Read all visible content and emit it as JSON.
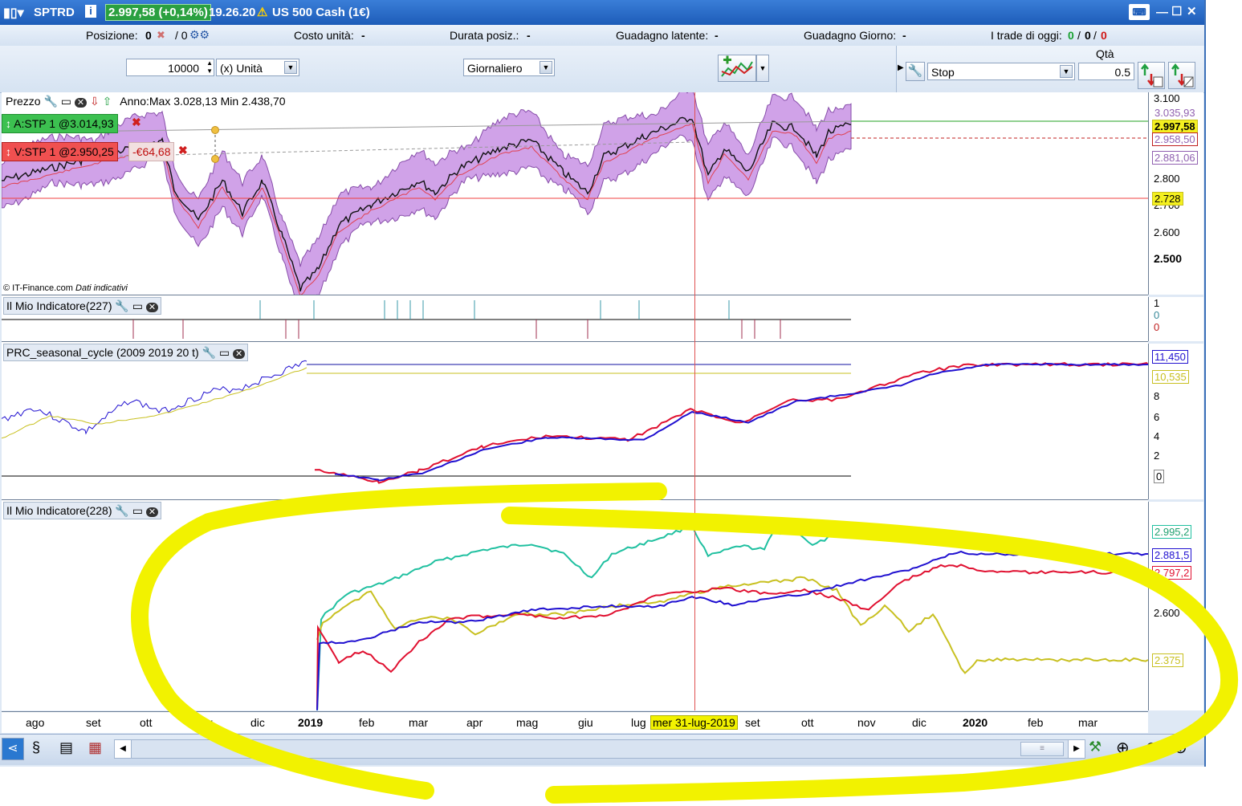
{
  "titlebar": {
    "symbol": "SPTRD",
    "info_icon": "i",
    "price": "2.997,58 (+0,14%)",
    "time": "19.26.20",
    "instrument": "US 500 Cash (1€)"
  },
  "position_bar": {
    "position_label": "Posizione:",
    "position_value": "0",
    "position_sep": "/ 0",
    "unit_cost_label": "Costo unità:",
    "unit_cost_value": "-",
    "duration_label": "Durata posiz.:",
    "duration_value": "-",
    "latent_label": "Guadagno latente:",
    "latent_value": "-",
    "day_gain_label": "Guadagno Giorno:",
    "day_gain_value": "-",
    "trades_label": "I trade di oggi:",
    "trades_a": "0",
    "trades_b": "0",
    "trades_c": "0",
    "sep": "/"
  },
  "toolbar": {
    "quantity": "10000",
    "unit_select": "(x) Unità",
    "timeframe": "Giornaliero",
    "order_type": "Stop",
    "qty_label": "Qtà",
    "qty_value": "0.5"
  },
  "price_panel": {
    "title": "Prezzo",
    "range_info": "Anno:Max 3.028,13 Min 2.438,70",
    "buy_order": "A:STP 1 @3.014,93",
    "sell_order": "V:STP 1 @2.950,25",
    "sell_pl": "-€64,68",
    "copyright": "© IT-Finance.com",
    "copyright_note": "Dati indicativi",
    "ticks": [
      "3.100",
      "2.800",
      "2.700",
      "2.600",
      "2.500"
    ],
    "tag_top": "3.035,93",
    "tag_last": "2.997,58",
    "tag_sell": "2.958,50",
    "tag_mid": "2.881,06",
    "tag_line": "2.728"
  },
  "ind227": {
    "title": "Il Mio Indicatore(227)",
    "ticks": [
      "1",
      "0",
      "0"
    ]
  },
  "seasonal": {
    "title": "PRC_seasonal_cycle (2009 2019 20 t)",
    "ticks": [
      "8",
      "6",
      "4",
      "2",
      "0"
    ],
    "tag_blue": "11,450",
    "tag_yellow": "10,535"
  },
  "ind228": {
    "title": "Il Mio Indicatore(228)",
    "ticks": [
      "2.600"
    ],
    "tag_green": "2.995,2",
    "tag_blue": "2.881,5",
    "tag_red": "2.797,2",
    "tag_yellow": "2.375"
  },
  "time_axis": {
    "labels": [
      "ago",
      "set",
      "ott",
      "nov",
      "dic",
      "2019",
      "feb",
      "mar",
      "apr",
      "mag",
      "giu",
      "lug",
      "set",
      "ott",
      "nov",
      "dic",
      "2020",
      "feb",
      "mar"
    ],
    "cursor_date": "mer 31-lug-2019"
  },
  "colors": {
    "band": "#cc99e6",
    "red": "#e01030",
    "blue": "#2010d0",
    "green": "#20c0a0",
    "yellow": "#c8c020",
    "highlight": "#f2f200"
  }
}
